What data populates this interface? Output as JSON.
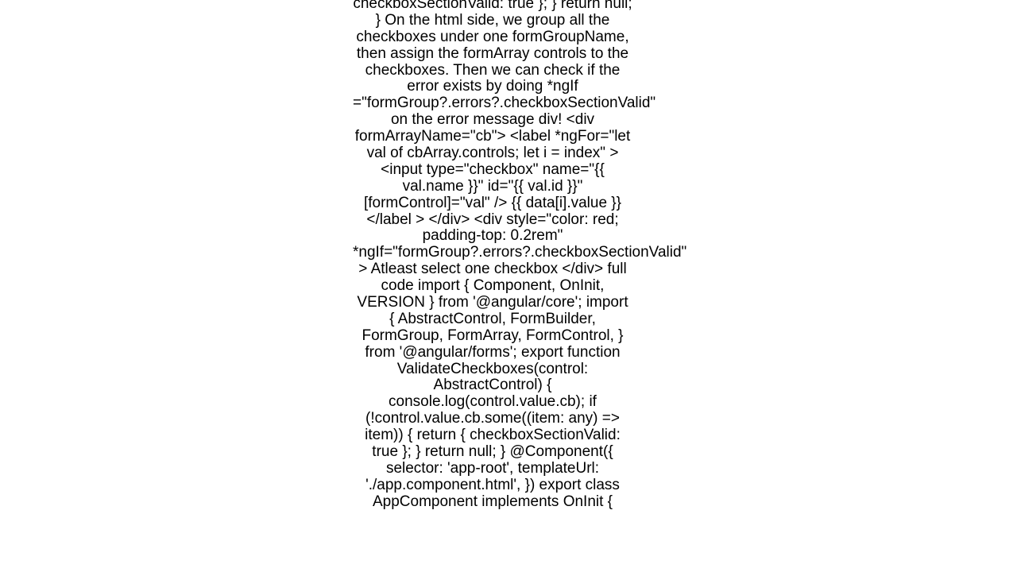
{
  "article": {
    "body_text": "checkboxSectionValid: true };   }   return null; }  On the html side, we group all the checkboxes under one formGroupName, then assign the formArray controls to the checkboxes. Then we can check if the error exists by doing *ngIf =\"formGroup?.errors?.checkboxSectionValid\" on the error message div! <div formArrayName=\"cb\">   <label *ngFor=\"let val of cbArray.controls; let i = index\"     ><input       type=\"checkbox\"       name=\"{{ val.name }}\"       id=\"{{ val.id }}\"       [formControl]=\"val\"     />     {{ data[i].value }}</label   > </div> <div   style=\"color: red; padding-top: 0.2rem\"   *ngIf=\"formGroup?.errors?.checkboxSectionValid\" >   Atleast select one checkbox </div>  full code import { Component, OnInit, VERSION } from '@angular/core'; import {   AbstractControl,   FormBuilder,   FormGroup,   FormArray,   FormControl, } from '@angular/forms';  export function ValidateCheckboxes(control: AbstractControl) {   console.log(control.value.cb);   if (!control.value.cb.some((item: any) => item)) {     return { checkboxSectionValid: true };   }   return null; }  @Component({   selector: 'app-root',   templateUrl: './app.component.html', }) export class AppComponent implements OnInit {"
  }
}
